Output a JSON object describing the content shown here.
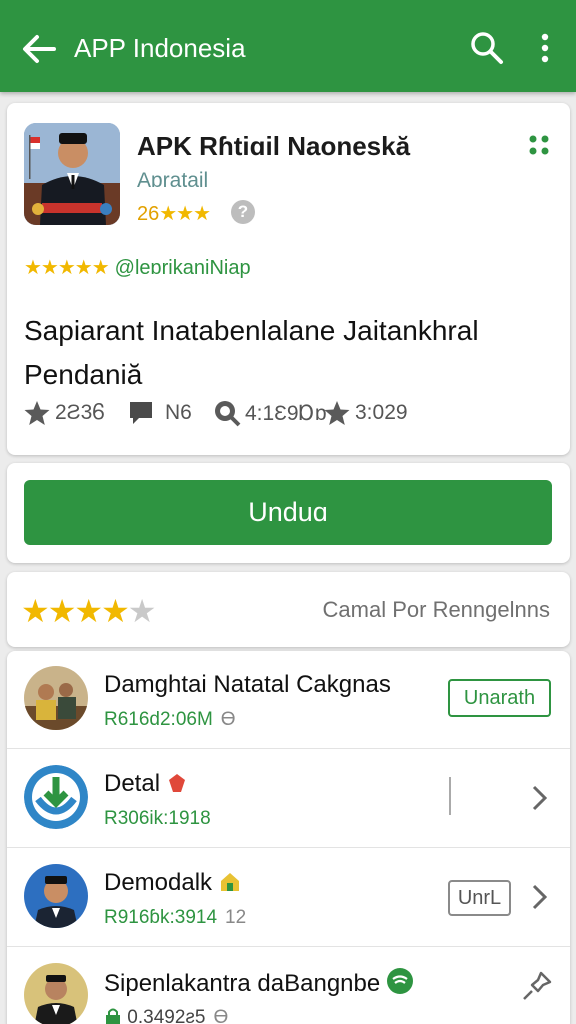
{
  "appbar": {
    "title": "APP Indonesia"
  },
  "app": {
    "name": "APK Rɦtiɑil Naoneskă",
    "developer": "Aɒratail",
    "rating": "26",
    "rating_stars": "★★★",
    "badge_stars": "★★★★★",
    "badge_text": "@leɒrikaniNiap",
    "description": "Sapiarant Inatabenlalane Jaitankhral Pendaniă",
    "stats": {
      "ratings": "2Ƨ3Ꮾ",
      "reviews": "N6",
      "downloads": "4:1Ɛ9Ɒɒ",
      "age": "3:029"
    }
  },
  "download_button": {
    "label": "Unduɑ"
  },
  "rating_bar": {
    "stars_on": "★★★★",
    "stars_off": "★",
    "label": "Camal Por Renngelnns"
  },
  "list": [
    {
      "title": "Damghtai Natatal Cakgnas",
      "meta": "R616d2:06M",
      "meta_extra": "ϴ",
      "action": "Unarath"
    },
    {
      "title": "Detal",
      "meta": "R306ik:1918",
      "meta_extra": "",
      "action": ""
    },
    {
      "title": "Demodalk",
      "meta": "R916ɓk:3914",
      "meta_extra": "12",
      "action": "UnrL"
    },
    {
      "title": "Sipenlakantra daBangnbe",
      "meta": "0.3492ƨ5",
      "meta_extra": "ϴ",
      "action": ""
    }
  ],
  "colors": {
    "brand_green": "#2e9441",
    "star": "#f1b800",
    "background": "#ececec"
  }
}
